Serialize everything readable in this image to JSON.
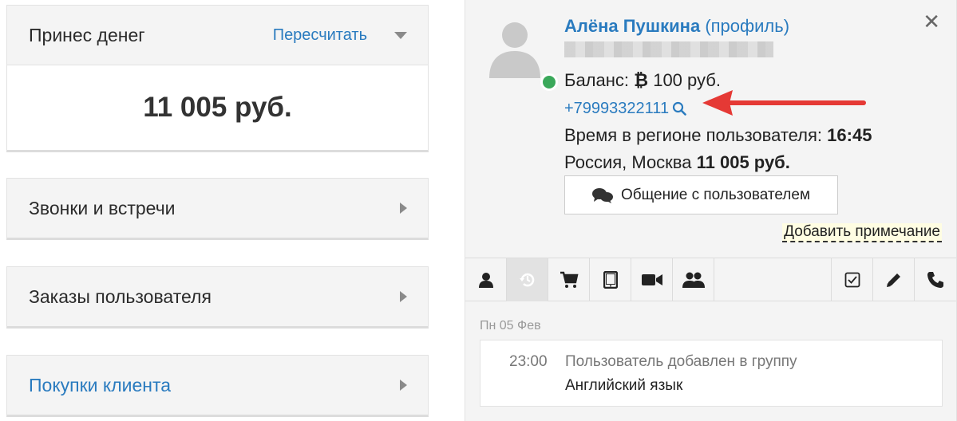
{
  "left": {
    "earned": {
      "label": "Принес денег",
      "recalc": "Пересчитать",
      "amount": "11 005 руб."
    },
    "sections": [
      {
        "label": "Звонки и встречи"
      },
      {
        "label": "Заказы пользователя"
      },
      {
        "label": "Покупки клиента"
      }
    ]
  },
  "user": {
    "name": "Алёна Пушкина",
    "profile_link": "(профиль)",
    "balance_label": "Баланс:",
    "balance_value": "100 руб.",
    "phone": "+79993322111",
    "time_label": "Время в регионе пользователя:",
    "time_value": "16:45",
    "location": "Россия, Москва",
    "total": "11 005 руб.",
    "chat_button": "Общение с пользователем",
    "add_note": "Добавить примечание"
  },
  "history": {
    "date": "Пн 05 Фев",
    "events": [
      {
        "time": "23:00",
        "title": "Пользователь добавлен в группу",
        "detail": "Английский язык"
      }
    ]
  },
  "colors": {
    "link": "#2a7bbf",
    "online": "#3aa85a",
    "arrow": "#e53935"
  }
}
